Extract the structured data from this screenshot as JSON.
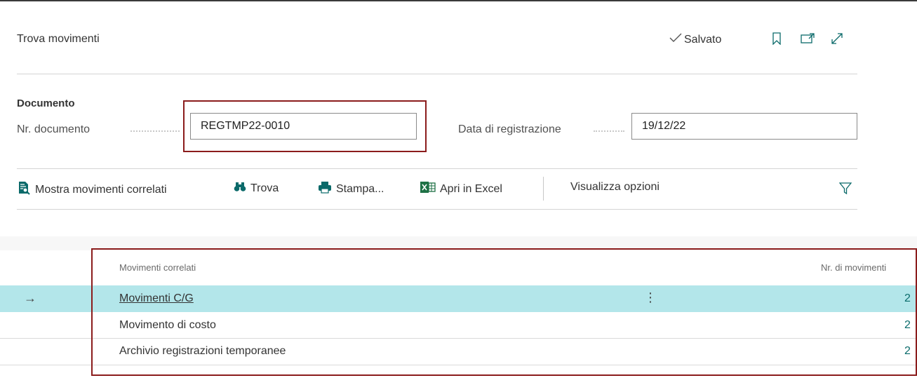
{
  "header": {
    "title": "Trova movimenti",
    "saved_label": "Salvato"
  },
  "document": {
    "group_title": "Documento",
    "doc_no_label": "Nr. documento",
    "doc_no_value": "REGTMP22-0010",
    "posting_date_label": "Data di registrazione",
    "posting_date_value": "19/12/22"
  },
  "toolbar": {
    "show_related": "Mostra movimenti correlati",
    "find": "Trova",
    "print": "Stampa...",
    "open_excel": "Apri in Excel",
    "view_options": "Visualizza opzioni"
  },
  "table": {
    "columns": [
      "Movimenti correlati",
      "Nr. di movimenti"
    ],
    "rows": [
      {
        "name": "Movimenti C/G",
        "count": "2"
      },
      {
        "name": "Movimento di costo",
        "count": "2"
      },
      {
        "name": "Archivio registrazioni temporanee",
        "count": "2"
      }
    ]
  },
  "colors": {
    "accent": "#0b6a6a",
    "selected_row": "#b3e6ea",
    "highlight_border": "#8b1c1c"
  }
}
